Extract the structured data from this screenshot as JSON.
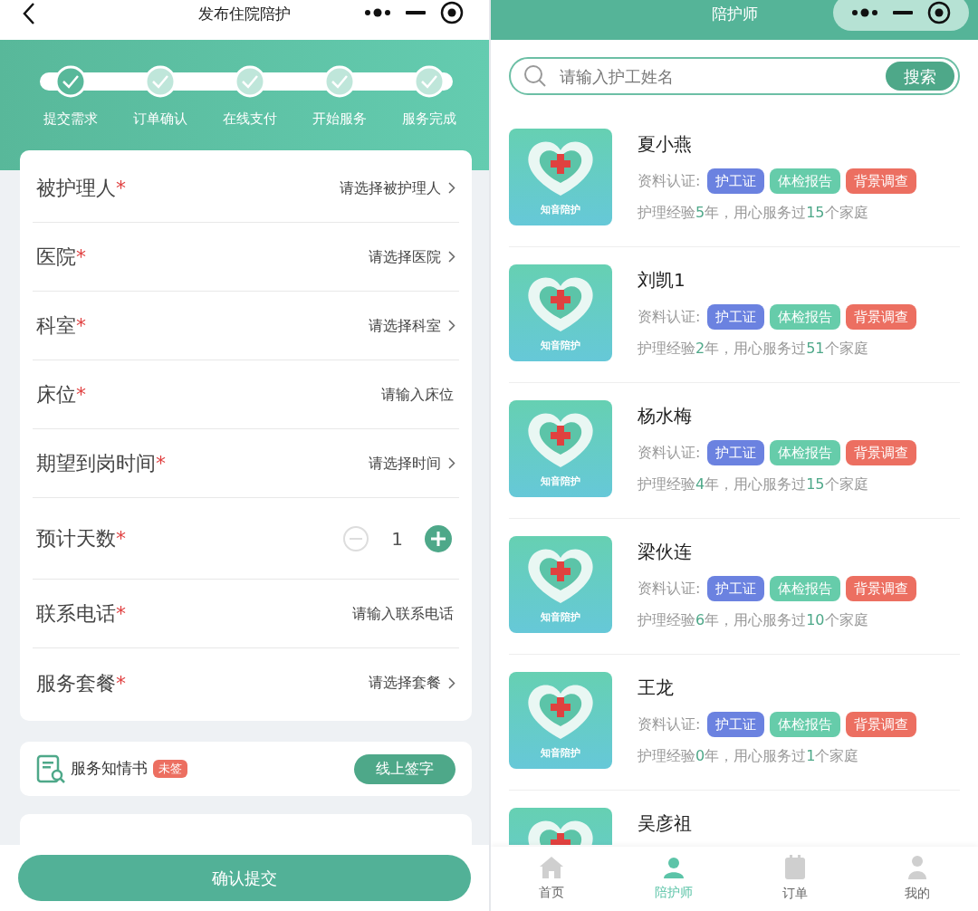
{
  "left_screen": {
    "title": "发布住院陪护",
    "steps": [
      {
        "label": "提交需求",
        "selected": true
      },
      {
        "label": "订单确认",
        "selected": false
      },
      {
        "label": "在线支付",
        "selected": false
      },
      {
        "label": "开始服务",
        "selected": false
      },
      {
        "label": "服务完成",
        "selected": false
      }
    ],
    "form_rows": [
      {
        "kind": "select",
        "label": "被护理人",
        "required_mark": "*",
        "placeholder": "请选择被护理人"
      },
      {
        "kind": "select",
        "label": "医院",
        "required_mark": "*",
        "placeholder": "请选择医院"
      },
      {
        "kind": "select",
        "label": "科室",
        "required_mark": "*",
        "placeholder": "请选择科室"
      },
      {
        "kind": "input",
        "label": "床位",
        "required_mark": "*",
        "placeholder": "请输入床位"
      },
      {
        "kind": "select",
        "label": "期望到岗时间",
        "required_mark": "*",
        "placeholder": "请选择时间"
      },
      {
        "kind": "stepper",
        "label": "预计天数",
        "required_mark": "*",
        "value": "1"
      },
      {
        "kind": "input",
        "label": "联系电话",
        "required_mark": "*",
        "placeholder": "请输入联系电话"
      },
      {
        "kind": "select",
        "label": "服务套餐",
        "required_mark": "*",
        "placeholder": "请选择套餐"
      }
    ],
    "consent": {
      "title": "服务知情书",
      "badge": "未签",
      "button": "线上签字"
    },
    "submit_button": "确认提交"
  },
  "right_screen": {
    "title": "陪护师",
    "search": {
      "placeholder": "请输入护工姓名",
      "button": "搜索"
    },
    "nurses": [
      {
        "name": "夏小燕",
        "logo_text": "知音陪护",
        "cert_label": "资料认证:",
        "tags": [
          {
            "label": "护工证",
            "color": "#6b82e0"
          },
          {
            "label": "体检报告",
            "color": "#66ccaa"
          },
          {
            "label": "背景调查",
            "color": "#ec6f61"
          }
        ],
        "experience": [
          {
            "text": "护理经验",
            "highlight": false
          },
          {
            "text": "5",
            "highlight": true
          },
          {
            "text": "年，用心服务过",
            "highlight": false
          },
          {
            "text": "15",
            "highlight": true
          },
          {
            "text": "个家庭",
            "highlight": false
          }
        ]
      },
      {
        "name": "刘凯1",
        "logo_text": "知音陪护",
        "cert_label": "资料认证:",
        "tags": [
          {
            "label": "护工证",
            "color": "#6b82e0"
          },
          {
            "label": "体检报告",
            "color": "#66ccaa"
          },
          {
            "label": "背景调查",
            "color": "#ec6f61"
          }
        ],
        "experience": [
          {
            "text": "护理经验",
            "highlight": false
          },
          {
            "text": "2",
            "highlight": true
          },
          {
            "text": "年，用心服务过",
            "highlight": false
          },
          {
            "text": "51",
            "highlight": true
          },
          {
            "text": "个家庭",
            "highlight": false
          }
        ]
      },
      {
        "name": "杨水梅",
        "logo_text": "知音陪护",
        "cert_label": "资料认证:",
        "tags": [
          {
            "label": "护工证",
            "color": "#6b82e0"
          },
          {
            "label": "体检报告",
            "color": "#66ccaa"
          },
          {
            "label": "背景调查",
            "color": "#ec6f61"
          }
        ],
        "experience": [
          {
            "text": "护理经验",
            "highlight": false
          },
          {
            "text": "4",
            "highlight": true
          },
          {
            "text": "年，用心服务过",
            "highlight": false
          },
          {
            "text": "15",
            "highlight": true
          },
          {
            "text": "个家庭",
            "highlight": false
          }
        ]
      },
      {
        "name": "梁伙连",
        "logo_text": "知音陪护",
        "cert_label": "资料认证:",
        "tags": [
          {
            "label": "护工证",
            "color": "#6b82e0"
          },
          {
            "label": "体检报告",
            "color": "#66ccaa"
          },
          {
            "label": "背景调查",
            "color": "#ec6f61"
          }
        ],
        "experience": [
          {
            "text": "护理经验",
            "highlight": false
          },
          {
            "text": "6",
            "highlight": true
          },
          {
            "text": "年，用心服务过",
            "highlight": false
          },
          {
            "text": "10",
            "highlight": true
          },
          {
            "text": "个家庭",
            "highlight": false
          }
        ]
      },
      {
        "name": "王龙",
        "logo_text": "知音陪护",
        "cert_label": "资料认证:",
        "tags": [
          {
            "label": "护工证",
            "color": "#6b82e0"
          },
          {
            "label": "体检报告",
            "color": "#66ccaa"
          },
          {
            "label": "背景调查",
            "color": "#ec6f61"
          }
        ],
        "experience": [
          {
            "text": "护理经验",
            "highlight": false
          },
          {
            "text": "0",
            "highlight": true
          },
          {
            "text": "年，用心服务过",
            "highlight": false
          },
          {
            "text": "1",
            "highlight": true
          },
          {
            "text": "个家庭",
            "highlight": false
          }
        ]
      },
      {
        "name": "吴彦祖"
      }
    ],
    "tab_bar": [
      {
        "kind": "home",
        "label": "首页",
        "selected": false
      },
      {
        "kind": "nurse",
        "label": "陪护师",
        "selected": true
      },
      {
        "kind": "order",
        "label": "订单",
        "selected": false
      },
      {
        "kind": "user",
        "label": "我的",
        "selected": false
      }
    ]
  }
}
